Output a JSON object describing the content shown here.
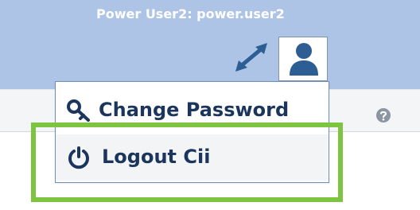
{
  "header": {
    "user_label": "Power User2: power.user2",
    "expand_icon": "expand-icon",
    "user_icon": "user-icon"
  },
  "toolbar": {
    "help_icon": "help-icon"
  },
  "user_menu": {
    "items": [
      {
        "label": "Change Password",
        "icon": "key-icon"
      },
      {
        "label": "Logout Cii",
        "icon": "power-icon"
      }
    ]
  },
  "colors": {
    "header_bg": "#adc4e6",
    "menu_text": "#1b355c",
    "icon_blue": "#2c5e94",
    "highlight": "#7dc540",
    "help_icon": "#8b95a3"
  }
}
